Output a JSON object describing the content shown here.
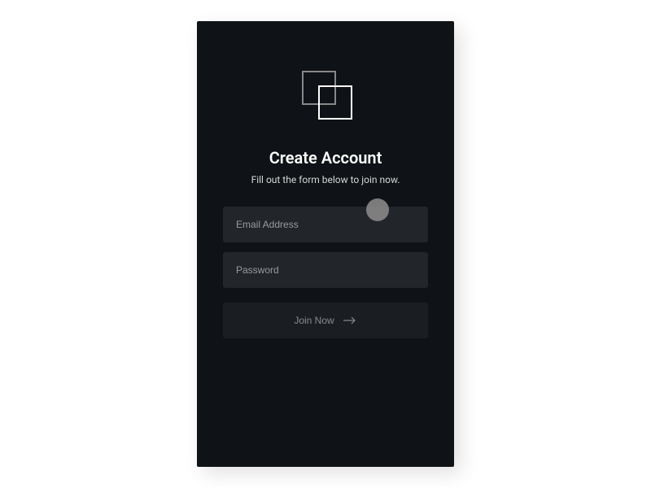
{
  "header": {
    "title": "Create Account",
    "subtitle": "Fill out the form below to join now."
  },
  "form": {
    "email_placeholder": "Email Address",
    "password_placeholder": "Password",
    "join_label": "Join Now"
  },
  "colors": {
    "bg": "#0f1216",
    "input_bg": "#22262b",
    "button_bg": "#1a1e23",
    "text_primary": "#ffffff",
    "text_muted": "#9a9a9a"
  },
  "icons": {
    "logo": "overlapping-squares",
    "arrow": "arrow-right"
  }
}
